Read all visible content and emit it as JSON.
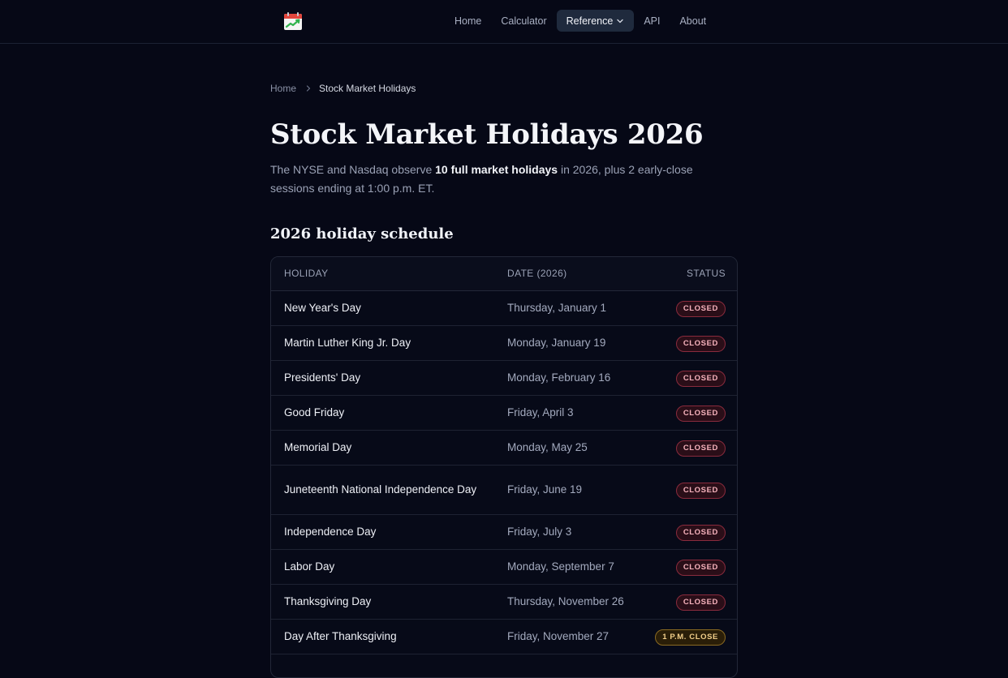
{
  "nav": {
    "items": [
      {
        "label": "Home",
        "active": false
      },
      {
        "label": "Calculator",
        "active": false
      },
      {
        "label": "Reference",
        "active": true,
        "has_dropdown": true
      },
      {
        "label": "API",
        "active": false
      },
      {
        "label": "About",
        "active": false
      }
    ]
  },
  "logo": {
    "icon": "calendar-chart-icon",
    "accent": "#e0453c",
    "chart_color": "#2fb24c"
  },
  "breadcrumb": {
    "home": "Home",
    "current": "Stock Market Holidays"
  },
  "page": {
    "title": "Stock Market Holidays 2026",
    "intro_pre": "The NYSE and Nasdaq observe ",
    "intro_bold": "10 full market holidays",
    "intro_post": " in 2026, plus 2 early-close sessions ending at 1:00 p.m. ET."
  },
  "schedule": {
    "heading": "2026 holiday schedule",
    "columns": {
      "holiday": "HOLIDAY",
      "date": "DATE (2026)",
      "status": "STATUS"
    },
    "rows": [
      {
        "holiday": "New Year's Day",
        "date": "Thursday, January 1",
        "status": "CLOSED",
        "kind": "closed"
      },
      {
        "holiday": "Martin Luther King Jr. Day",
        "date": "Monday, January 19",
        "status": "CLOSED",
        "kind": "closed"
      },
      {
        "holiday": "Presidents' Day",
        "date": "Monday, February 16",
        "status": "CLOSED",
        "kind": "closed"
      },
      {
        "holiday": "Good Friday",
        "date": "Friday, April 3",
        "status": "CLOSED",
        "kind": "closed"
      },
      {
        "holiday": "Memorial Day",
        "date": "Monday, May 25",
        "status": "CLOSED",
        "kind": "closed"
      },
      {
        "holiday": "Juneteenth National Independence Day",
        "date": "Friday, June 19",
        "status": "CLOSED",
        "kind": "closed"
      },
      {
        "holiday": "Independence Day",
        "date": "Friday, July 3",
        "status": "CLOSED",
        "kind": "closed"
      },
      {
        "holiday": "Labor Day",
        "date": "Monday, September 7",
        "status": "CLOSED",
        "kind": "closed"
      },
      {
        "holiday": "Thanksgiving Day",
        "date": "Thursday, November 26",
        "status": "CLOSED",
        "kind": "closed"
      },
      {
        "holiday": "Day After Thanksgiving",
        "date": "Friday, November 27",
        "status": "1 P.M. CLOSE",
        "kind": "early"
      }
    ]
  },
  "colors": {
    "background": "#060816",
    "closed_badge": "#f7b3bd",
    "early_badge": "#f2cf8a"
  }
}
